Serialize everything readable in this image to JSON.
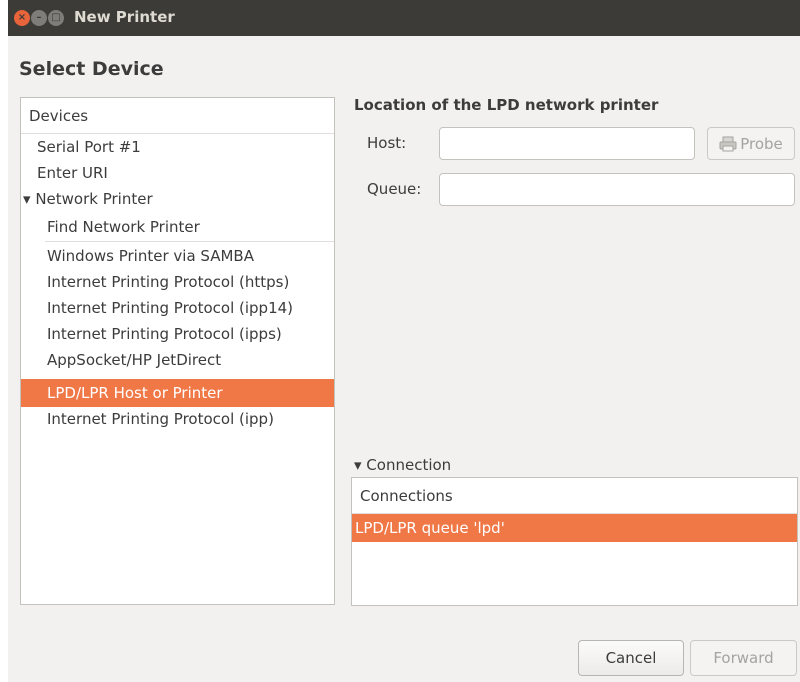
{
  "window": {
    "title": "New Printer",
    "controls": {
      "close": "×",
      "minimize": "–",
      "maximize": "□"
    }
  },
  "heading": "Select Device",
  "devices": {
    "header": "Devices",
    "items": [
      {
        "label": "Serial Port #1",
        "level": 0
      },
      {
        "label": "Enter URI",
        "level": 0
      },
      {
        "label": "Network Printer",
        "level": 0,
        "expanded": true,
        "expander": "▾"
      },
      {
        "label": "Find Network Printer",
        "level": 1
      },
      {
        "label": "Windows Printer via SAMBA",
        "level": 1
      },
      {
        "label": "Internet Printing Protocol (https)",
        "level": 1
      },
      {
        "label": "Internet Printing Protocol (ipp14)",
        "level": 1
      },
      {
        "label": "Internet Printing Protocol (ipps)",
        "level": 1
      },
      {
        "label": "AppSocket/HP JetDirect",
        "level": 1
      },
      {
        "label": "LPD/LPR Host or Printer",
        "level": 1,
        "selected": true
      },
      {
        "label": "Internet Printing Protocol (ipp)",
        "level": 1
      }
    ]
  },
  "location": {
    "title": "Location of the LPD network printer",
    "host_label": "Host:",
    "host_value": "",
    "probe_label": "Probe",
    "probe_icon": "printer-probe-icon",
    "queue_label": "Queue:",
    "queue_value": ""
  },
  "connection": {
    "expander_label": "▾ Connection",
    "header": "Connections",
    "items": [
      "LPD/LPR queue 'lpd'"
    ]
  },
  "buttons": {
    "cancel": "Cancel",
    "forward": "Forward"
  },
  "colors": {
    "accent": "#f07746",
    "titlebar": "#3c3b37",
    "close_button": "#e8643a"
  }
}
